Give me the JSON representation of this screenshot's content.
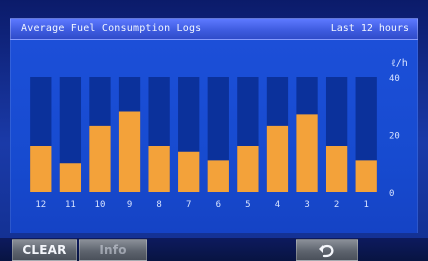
{
  "header": {
    "title": "Average Fuel Consumption Logs",
    "range": "Last 12 hours"
  },
  "chart_data": {
    "type": "bar",
    "unit": "ℓ/h",
    "y_ticks": [
      "40",
      "20",
      "0"
    ],
    "ylim": [
      0,
      40
    ],
    "categories": [
      "12",
      "11",
      "10",
      "9",
      "8",
      "7",
      "6",
      "5",
      "4",
      "3",
      "2",
      "1"
    ],
    "values": [
      16,
      10,
      23,
      28,
      16,
      14,
      11,
      16,
      23,
      27,
      16,
      11
    ],
    "bar_color": "#f3a23a",
    "bar_bg_color": "#0b2f98"
  },
  "footer": {
    "clear_label": "CLEAR",
    "mode_label": "Info",
    "back_icon": "return-icon"
  }
}
